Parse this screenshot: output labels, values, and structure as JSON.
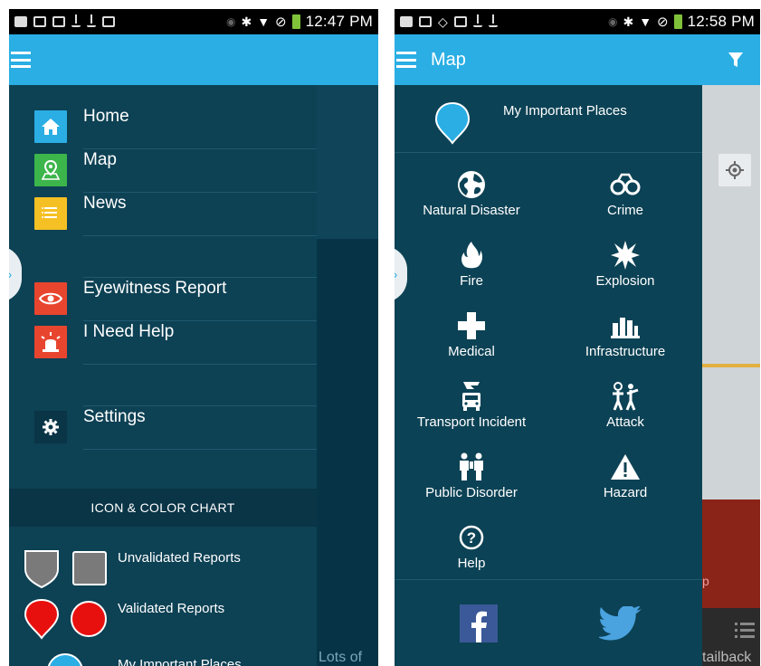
{
  "left_screen": {
    "status_bar": {
      "time": "12:47 PM"
    },
    "nav": {
      "items": [
        {
          "label": "Home",
          "icon": "home-icon",
          "color": "#2aaee4"
        },
        {
          "label": "Map",
          "icon": "map-pin-icon",
          "color": "#3cb54a"
        },
        {
          "label": "News",
          "icon": "news-icon",
          "color": "#f5c024"
        },
        {
          "label": "Eyewitness Report",
          "icon": "eye-icon",
          "color": "#e8452f"
        },
        {
          "label": "I Need Help",
          "icon": "siren-icon",
          "color": "#e8452f"
        },
        {
          "label": "Settings",
          "icon": "gear-icon",
          "color": "#0a3547"
        }
      ]
    },
    "legend": {
      "header": "ICON & COLOR CHART",
      "rows": [
        {
          "label": "Unvalidated Reports",
          "color": "#7a7a7a"
        },
        {
          "label": "Validated Reports",
          "color": "#e8100f"
        },
        {
          "label": "My Important Places",
          "color": "#2aaee4"
        }
      ]
    },
    "behind_text": "Lots of"
  },
  "right_screen": {
    "status_bar": {
      "time": "12:58 PM"
    },
    "app_bar": {
      "title": "Map"
    },
    "important_places": {
      "label": "My Important Places",
      "color": "#2aaee4"
    },
    "categories": [
      {
        "label": "Natural Disaster",
        "icon": "globe-icon"
      },
      {
        "label": "Crime",
        "icon": "handcuffs-icon"
      },
      {
        "label": "Fire",
        "icon": "fire-icon"
      },
      {
        "label": "Explosion",
        "icon": "explosion-icon"
      },
      {
        "label": "Medical",
        "icon": "medical-cross-icon"
      },
      {
        "label": "Infrastructure",
        "icon": "infrastructure-icon"
      },
      {
        "label": "Transport Incident",
        "icon": "transport-icon"
      },
      {
        "label": "Attack",
        "icon": "attack-icon"
      },
      {
        "label": "Public Disorder",
        "icon": "public-disorder-icon"
      },
      {
        "label": "Hazard",
        "icon": "hazard-icon"
      },
      {
        "label": "Help",
        "icon": "help-icon"
      }
    ],
    "social": [
      {
        "name": "facebook",
        "icon": "facebook-icon",
        "color": "#3b5998"
      },
      {
        "name": "twitter",
        "icon": "twitter-icon",
        "color": "#4aa3df"
      }
    ],
    "map_text": {
      "p": "p",
      "bottom": "tailback"
    }
  }
}
